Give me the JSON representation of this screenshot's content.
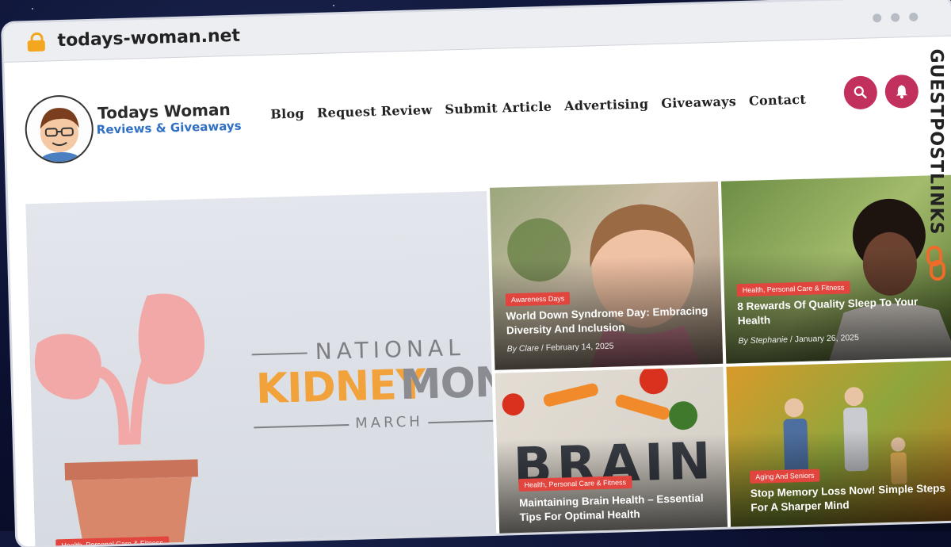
{
  "browser": {
    "url": "todays-woman.net"
  },
  "site": {
    "logo_title": "Todays Woman",
    "logo_subtitle": "Reviews & Giveaways"
  },
  "nav": {
    "items": [
      "Blog",
      "Request Review",
      "Submit Article",
      "Advertising",
      "Giveaways",
      "Contact"
    ]
  },
  "header_actions": {
    "search_icon": "search-icon",
    "bell_icon": "bell-icon"
  },
  "hero": {
    "image_text_line1": "NATIONAL",
    "image_text_kidney": "KIDNEY",
    "image_text_month": "MONT",
    "image_text_line3": "MARCH",
    "category": "Health, Personal Care & Fitness"
  },
  "cards": [
    {
      "category": "Awareness Days",
      "title": "World Down Syndrome Day: Embracing Diversity And Inclusion",
      "author": "Clare",
      "date": "February 14, 2025"
    },
    {
      "category": "Health, Personal Care & Fitness",
      "title": "8 Rewards Of Quality Sleep To Your Health",
      "author": "Stephanie",
      "date": "January 26, 2025"
    },
    {
      "category": "Health, Personal Care & Fitness",
      "title": "Maintaining Brain Health – Essential Tips For Optimal Health",
      "author": "",
      "date": ""
    },
    {
      "category": "Aging And Seniors",
      "title": "Stop Memory Loss Now! Simple Steps For A Sharper Mind",
      "author": "",
      "date": ""
    }
  ],
  "meta_labels": {
    "by": "By",
    "sep": "/"
  },
  "watermark": {
    "text": "GUESTPOSTLINKS"
  },
  "colors": {
    "accent": "#c2315d",
    "tag": "#e2453d",
    "logo_blue": "#2f6fc4"
  }
}
